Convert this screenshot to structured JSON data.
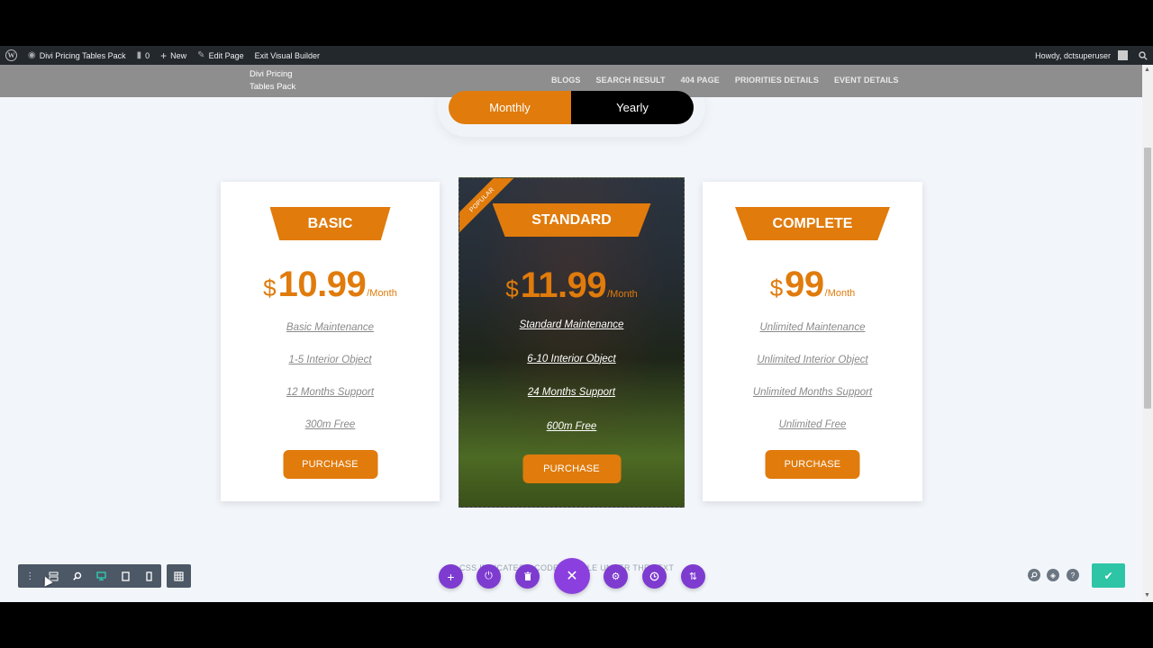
{
  "admin_bar": {
    "site_name": "Divi Pricing Tables Pack",
    "comments_count": "0",
    "new_label": "New",
    "edit_page_label": "Edit Page",
    "exit_builder_label": "Exit Visual Builder",
    "howdy": "Howdy, dctsuperuser"
  },
  "header": {
    "logo_line1": "Divi Pricing",
    "logo_line2": "Tables Pack",
    "nav": [
      "BLOGS",
      "SEARCH RESULT",
      "404 PAGE",
      "PRIORITIES DETAILS",
      "EVENT DETAILS"
    ]
  },
  "toggle": {
    "monthly": "Monthly",
    "yearly": "Yearly",
    "active": "Monthly"
  },
  "plans": [
    {
      "name": "BASIC",
      "currency": "$",
      "price": "10.99",
      "period": "/Month",
      "features": [
        "Basic Maintenance",
        "1-5 Interior Object",
        "12 Months Support",
        "300m Free"
      ],
      "button": "PURCHASE"
    },
    {
      "name": "STANDARD",
      "badge": "POPULAR",
      "currency": "$",
      "price": "11.99",
      "period": "/Month",
      "features": [
        "Standard Maintenance",
        "6-10 Interior Object",
        "24 Months Support",
        "600m Free"
      ],
      "button": "PURCHASE"
    },
    {
      "name": "COMPLETE",
      "currency": "$",
      "price": "99",
      "period": "/Month",
      "features": [
        "Unlimited Maintenance",
        "Unlimited Interior Object",
        "Unlimited Months Support",
        "Unlimited Free"
      ],
      "button": "PURCHASE"
    }
  ],
  "under_text": "CSS INDICATES A CODE MODULE UNDER THE TEXT",
  "colors": {
    "accent": "#e07b0c",
    "divi_purple": "#7e3bd0",
    "save_green": "#2ec4a6",
    "toolbar": "#4c5866"
  },
  "toolbar_icons": [
    "menu-dots-icon",
    "wireframe-icon",
    "zoom-icon",
    "desktop-icon",
    "tablet-icon",
    "phone-icon",
    "grid-icon"
  ],
  "fab_icons": [
    "plus-icon",
    "power-icon",
    "trash-icon",
    "close-icon",
    "settings-icon",
    "history-icon",
    "sort-icon"
  ]
}
